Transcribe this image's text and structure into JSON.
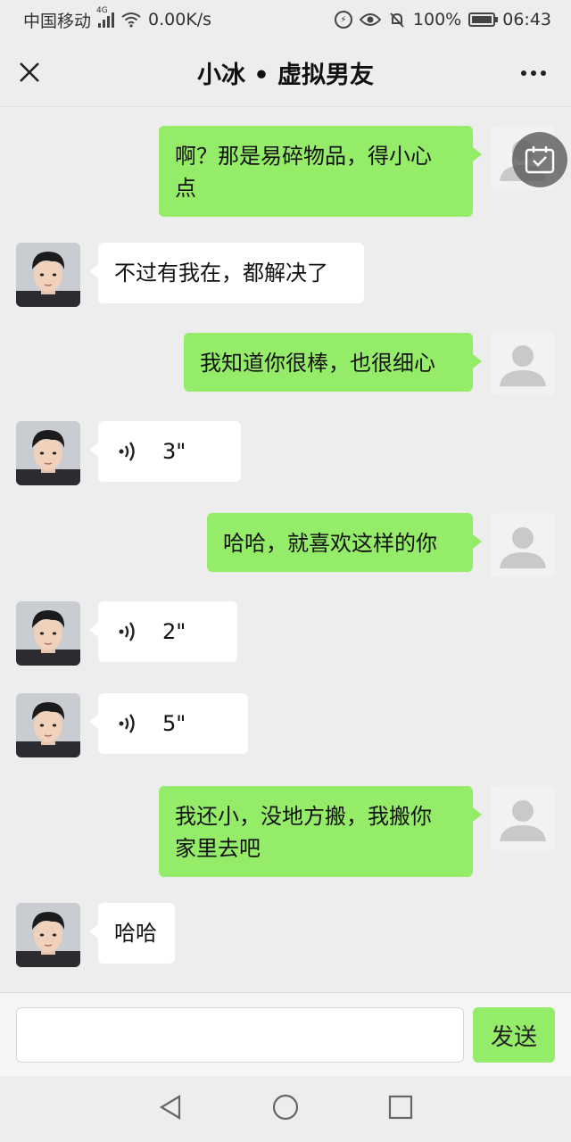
{
  "status_bar": {
    "carrier": "中国移动",
    "network": "4G",
    "speed": "0.00K/s",
    "battery": "100%",
    "time": "06:43"
  },
  "header": {
    "title": "小冰 • 虚拟男友"
  },
  "messages": [
    {
      "from": "me",
      "text_line1": "啊？那是易碎物品，得小心",
      "text_line2": "点"
    },
    {
      "from": "them",
      "text": "不过有我在，都解决了"
    },
    {
      "from": "me",
      "text": "我知道你很棒，也很细心"
    },
    {
      "from": "them",
      "type": "voice",
      "duration": "3\""
    },
    {
      "from": "me",
      "text": "哈哈，就喜欢这样的你"
    },
    {
      "from": "them",
      "type": "voice",
      "duration": "2\""
    },
    {
      "from": "them",
      "type": "voice",
      "duration": "5\""
    },
    {
      "from": "me",
      "text_line1": "我还小，没地方搬，我搬你",
      "text_line2": "家里去吧"
    },
    {
      "from": "them",
      "text": "哈哈"
    }
  ],
  "input": {
    "value": "",
    "placeholder": ""
  },
  "send_label": "发送",
  "colors": {
    "my_bubble": "#95ec69",
    "their_bubble": "#ffffff",
    "background": "#ededed"
  }
}
